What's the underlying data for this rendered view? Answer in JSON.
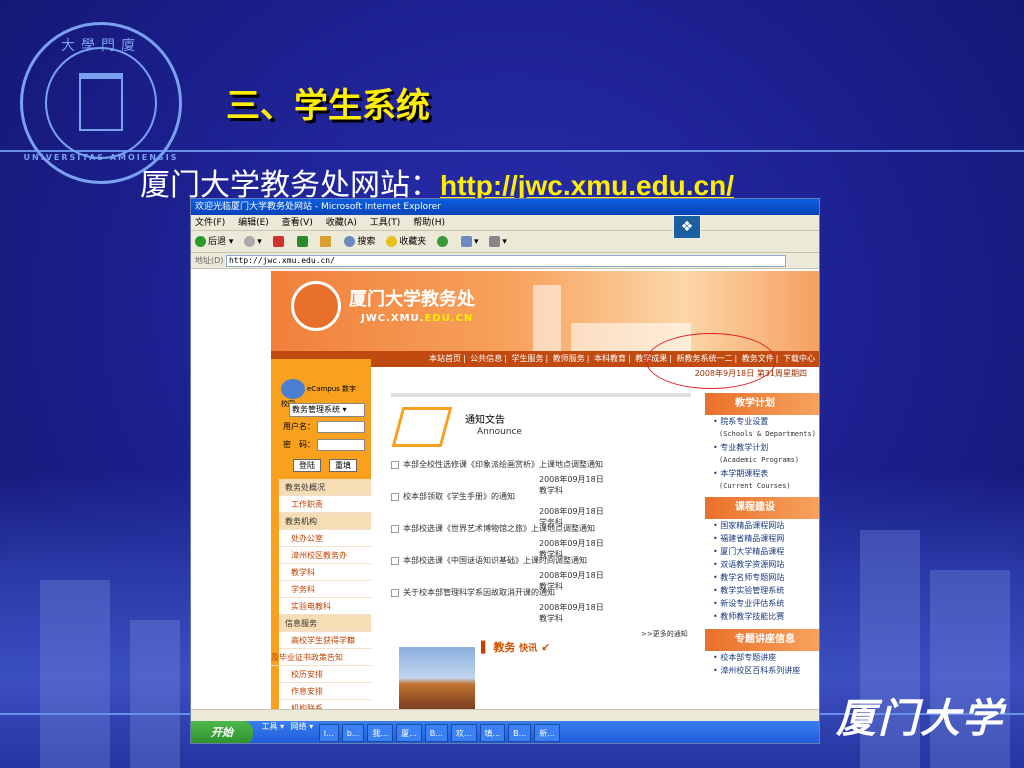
{
  "slide": {
    "title": "三、学生系统",
    "subtitle_prefix": "厦门大学教务处网站：",
    "link": "http://jwc.xmu.edu.cn/",
    "calligraphy": "厦门大学",
    "seal_top_text": "大學門廈",
    "seal_bottom_text": "UNIVERSITAS AMOIENSIS"
  },
  "browser": {
    "window_title": "欢迎光临厦门大学教务处网站 - Microsoft Internet Explorer",
    "menu": [
      "文件(F)",
      "编辑(E)",
      "查看(V)",
      "收藏(A)",
      "工具(T)",
      "帮助(H)"
    ],
    "toolbar": {
      "back": "后退",
      "search": "搜索",
      "favorites": "收藏夹"
    },
    "address_label": "地址(D)",
    "address": "http://jwc.xmu.edu.cn/"
  },
  "site": {
    "banner_title": "厦门大学教务处",
    "banner_sub_a": "JWC.XMU.",
    "banner_sub_b": "EDU.CN",
    "nav": [
      "本站首页",
      "公共信息",
      "学生服务",
      "教师服务",
      "本科教育",
      "教学成果",
      "新教务系统一二",
      "教务文件",
      "下载中心"
    ],
    "date": "2008年9月18日 第31周星期四",
    "login": {
      "ecampus": "eCampus 数字校园",
      "system": "教务管理系统",
      "user_label": "用户名：",
      "pwd_label": "密　码：",
      "login_btn": "登陆",
      "reset_btn": "重填"
    },
    "left_menu": [
      {
        "label": "教务处概况",
        "type": "head"
      },
      {
        "label": "工作职责",
        "type": "sub"
      },
      {
        "label": "教务机构",
        "type": "head"
      },
      {
        "label": "处办公室",
        "type": "sub"
      },
      {
        "label": "漳州校区教务办",
        "type": "sub"
      },
      {
        "label": "教学科",
        "type": "sub"
      },
      {
        "label": "学务科",
        "type": "sub"
      },
      {
        "label": "实验电教科",
        "type": "sub"
      },
      {
        "label": "信息服务",
        "type": "head"
      },
      {
        "label": "高校学生获得学籍",
        "type": "sub"
      },
      {
        "label": "及毕业证书政策告知",
        "type": "cont"
      },
      {
        "label": "校历安排",
        "type": "sub"
      },
      {
        "label": "作息安排",
        "type": "sub"
      },
      {
        "label": "机构联系",
        "type": "sub"
      }
    ],
    "notice": {
      "title": "通知文告",
      "title_en": "Announce",
      "items": [
        {
          "title": "本部全校性选修课《印象派绘画赏析》上课地点调整通知",
          "date": "2008年09月18日",
          "dept": "教学科"
        },
        {
          "title": "校本部领取《学生手册》的通知",
          "date": "2008年09月18日",
          "dept": "学务科"
        },
        {
          "title": "本部校选课《世界艺术博物馆之旅》上课地点调整通知",
          "date": "2008年09月18日",
          "dept": "教学科"
        },
        {
          "title": "本部校选课《中国谜语知识基础》上课时间调整通知",
          "date": "2008年09月18日",
          "dept": "教学科"
        },
        {
          "title": "关于校本部管理科学系因故取消开课的通知",
          "date": "2008年09月18日",
          "dept": "教学科"
        }
      ],
      "more": ">>更多的通知"
    },
    "kuaixun_a": "教务",
    "kuaixun_b": "快讯",
    "right": {
      "plan_head": "教学计划",
      "plan_items": [
        {
          "text": "院系专业设置",
          "en": "(Schools & Departments)"
        },
        {
          "text": "专业教学计划",
          "en": "(Academic Programs)"
        },
        {
          "text": "本学期课程表",
          "en": "(Current Courses)"
        }
      ],
      "course_head": "课程建设",
      "course_items": [
        "国家精品课程网站",
        "福建省精品课程网",
        "厦门大学精品课程",
        "双语教学资源网站",
        "教学名师专题网站",
        "教学实验管理系统",
        "新设专业评估系统",
        "教师教学技能比赛"
      ],
      "lecture_head": "专题讲座信息",
      "lecture_items": [
        "校本部专题讲座",
        "漳州校区百科系列讲座"
      ]
    }
  },
  "taskbar": {
    "start": "开始",
    "tools": "工具",
    "network": "网络",
    "tasks": [
      "I...",
      "b...",
      "我...",
      "厦...",
      "B...",
      "欢...",
      "填...",
      "B...",
      "新..."
    ]
  }
}
